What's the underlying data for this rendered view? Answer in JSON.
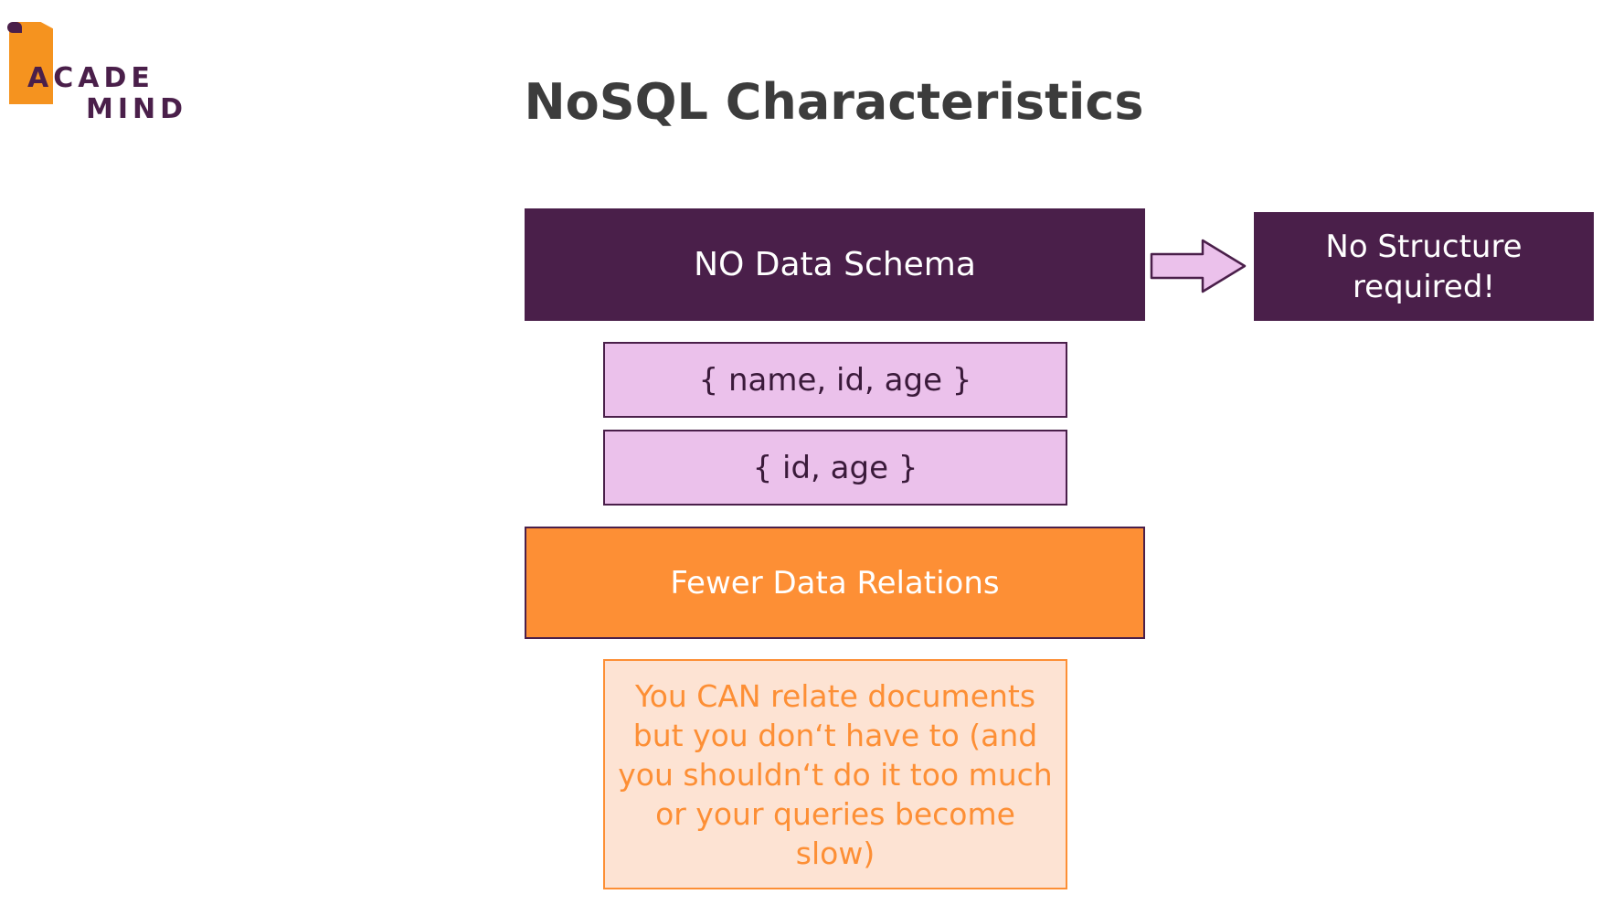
{
  "logo": {
    "line1": "ACADE",
    "line2": "MIND"
  },
  "title": "NoSQL Characteristics",
  "diagram": {
    "schema_box": "NO Data Schema",
    "structure_box": "No Structure required!",
    "documents": [
      "{ name, id, age }",
      "{ id, age }"
    ],
    "relations_box": "Fewer Data Relations",
    "relations_note": "You CAN relate documents but you don‘t have to (and you shouldn‘t do it too much or your queries become slow)"
  },
  "colors": {
    "purple": "#4a1f4a",
    "light_purple": "#ebc1eb",
    "orange": "#fd8f35",
    "light_orange": "#fde3d3",
    "title_text": "#3c3c3c"
  },
  "icons": {
    "logo": "bookmark-logo-icon",
    "arrow": "right-arrow-icon"
  }
}
